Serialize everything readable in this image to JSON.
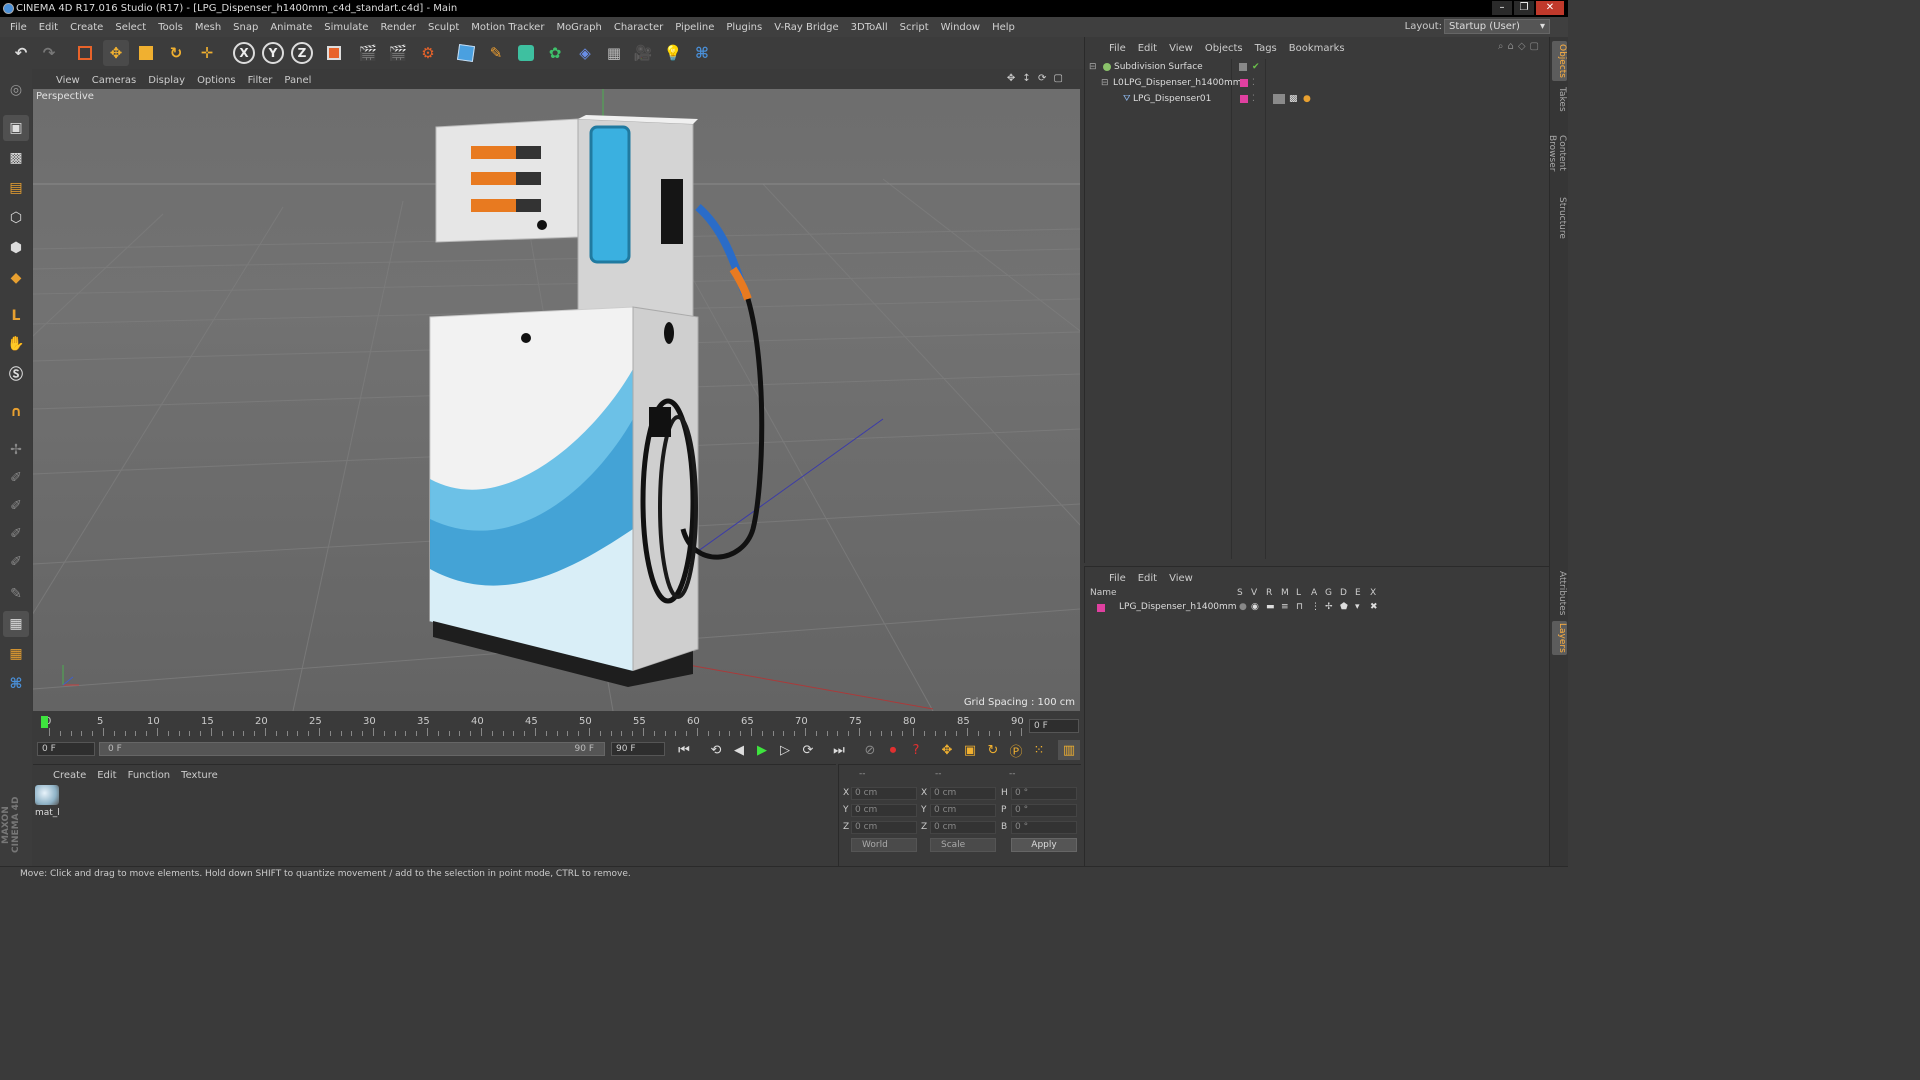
{
  "window": {
    "title": "CINEMA 4D R17.016 Studio (R17) - [LPG_Dispenser_h1400mm_c4d_standart.c4d] - Main",
    "buttons": [
      "–",
      "❐",
      "✕"
    ]
  },
  "menubar": [
    "File",
    "Edit",
    "Create",
    "Select",
    "Tools",
    "Mesh",
    "Snap",
    "Animate",
    "Simulate",
    "Render",
    "Sculpt",
    "Motion Tracker",
    "MoGraph",
    "Character",
    "Pipeline",
    "Plugins",
    "V-Ray Bridge",
    "3DToAll",
    "Script",
    "Window",
    "Help"
  ],
  "layout": {
    "label": "Layout:",
    "value": "Startup (User)"
  },
  "toolbar": {
    "axis_x": "X",
    "axis_y": "Y",
    "axis_z": "Z",
    "icons": [
      "undo-icon",
      "redo-icon",
      "live-selection-icon",
      "move-icon",
      "scale-icon",
      "rotate-icon",
      "transform-icon",
      "x-axis-lock-icon",
      "y-axis-lock-icon",
      "z-axis-lock-icon",
      "coordinate-system-icon",
      "render-view-icon",
      "render-picture-viewer-icon",
      "render-settings-icon",
      "cube-icon",
      "pen-spline-icon",
      "subdivision-icon",
      "cloner-icon",
      "deformer-icon",
      "floor-icon",
      "camera-icon",
      "light-icon",
      "python-icon"
    ]
  },
  "viewport": {
    "menu": [
      "View",
      "Cameras",
      "Display",
      "Options",
      "Filter",
      "Panel"
    ],
    "label": "Perspective",
    "grid_spacing": "Grid Spacing : 100 cm",
    "background": "#6e6e6e"
  },
  "timeline": {
    "ticks": [
      "0",
      "5",
      "10",
      "15",
      "20",
      "25",
      "30",
      "35",
      "40",
      "45",
      "50",
      "55",
      "60",
      "65",
      "70",
      "75",
      "80",
      "85",
      "90"
    ],
    "current_frame": "0 F",
    "start_field": "0 F",
    "range_start": "0 F",
    "range_end": "90 F",
    "end_field": "90 F"
  },
  "material_manager": {
    "menu": [
      "Create",
      "Edit",
      "Function",
      "Texture"
    ],
    "materials": [
      "mat_l"
    ]
  },
  "coordinates": {
    "headers": [
      "--",
      "--",
      "--"
    ],
    "rows": [
      {
        "axis": "X",
        "pos": "0 cm",
        "size_axis": "X",
        "size": "0 cm",
        "rot_axis": "H",
        "rot": "0 °"
      },
      {
        "axis": "Y",
        "pos": "0 cm",
        "size_axis": "Y",
        "size": "0 cm",
        "rot_axis": "P",
        "rot": "0 °"
      },
      {
        "axis": "Z",
        "pos": "0 cm",
        "size_axis": "Z",
        "size": "0 cm",
        "rot_axis": "B",
        "rot": "0 °"
      }
    ],
    "mode": "World",
    "transform": "Scale",
    "apply": "Apply"
  },
  "object_manager": {
    "menu": [
      "File",
      "Edit",
      "View",
      "Objects",
      "Tags",
      "Bookmarks"
    ],
    "objects": [
      {
        "name": "Subdivision Surface",
        "color": "#8ac26a"
      },
      {
        "name": "LPG_Dispenser_h1400mm",
        "color": "#e040a0"
      },
      {
        "name": "LPG_Dispenser01",
        "color": "#e040a0"
      }
    ]
  },
  "layer_manager": {
    "menu": [
      "File",
      "Edit",
      "View"
    ],
    "columns": [
      "Name",
      "S",
      "V",
      "R",
      "M",
      "L",
      "A",
      "G",
      "D",
      "E",
      "X"
    ],
    "layers": [
      {
        "name": "LPG_Dispenser_h1400mm",
        "color": "#e040a0"
      }
    ]
  },
  "right_tabs": [
    "Objects",
    "Takes",
    "Content Browser",
    "Structure",
    "Attributes",
    "Layers"
  ],
  "status": "Move: Click and drag to move elements. Hold down SHIFT to quantize movement / add to the selection in point mode, CTRL to remove.",
  "brand": "MAXON CINEMA 4D"
}
